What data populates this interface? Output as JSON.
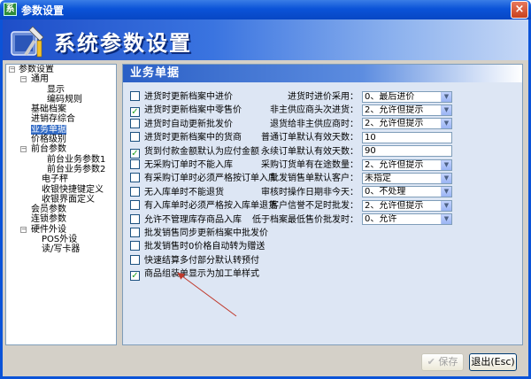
{
  "window": {
    "title": "参数设置",
    "close_glyph": "×"
  },
  "banner": {
    "title": "系统参数设置"
  },
  "tree": {
    "nodes": [
      {
        "label": "参数设置",
        "level": "0",
        "expander": "−"
      },
      {
        "label": "通用",
        "level": "1",
        "expander": "−"
      },
      {
        "label": "显示",
        "level": "2b"
      },
      {
        "label": "编码规则",
        "level": "2b"
      },
      {
        "label": "基础档案",
        "level": "1"
      },
      {
        "label": "进销存综合",
        "level": "1"
      },
      {
        "label": "业务单据",
        "level": "1",
        "selected": true
      },
      {
        "label": "价格级别",
        "level": "1"
      },
      {
        "label": "前台参数",
        "level": "1",
        "expander": "−"
      },
      {
        "label": "前台业务参数1",
        "level": "2b"
      },
      {
        "label": "前台业务参数2",
        "level": "2b"
      },
      {
        "label": "电子秤",
        "level": "2"
      },
      {
        "label": "收银快捷键定义",
        "level": "2"
      },
      {
        "label": "收银界面定义",
        "level": "2"
      },
      {
        "label": "会员参数",
        "level": "1"
      },
      {
        "label": "连锁参数",
        "level": "1"
      },
      {
        "label": "硬件外设",
        "level": "1",
        "expander": "−"
      },
      {
        "label": "POS外设",
        "level": "2"
      },
      {
        "label": "读/写卡器",
        "level": "2"
      }
    ]
  },
  "panel": {
    "header": "业务单据",
    "checkboxes": [
      {
        "label": "进货时更新档案中进价",
        "checked": false
      },
      {
        "label": "进货时更新档案中零售价",
        "checked": true
      },
      {
        "label": "进货时自动更新批发价",
        "checked": false
      },
      {
        "label": "进货时更新档案中的货商",
        "checked": false
      },
      {
        "label": "货到付款金额默认为应付金额",
        "checked": true
      },
      {
        "label": "无采购订单时不能入库",
        "checked": false
      },
      {
        "label": "有采购订单时必须严格按订单入库",
        "checked": false
      },
      {
        "label": "无入库单时不能退货",
        "checked": false
      },
      {
        "label": "有入库单时必须严格按入库单退货",
        "checked": false
      },
      {
        "label": "允许不管理库存商品入库",
        "checked": false
      },
      {
        "label": "批发销售同步更新档案中批发价",
        "checked": false
      },
      {
        "label": "批发销售时0价格自动转为赠送",
        "checked": false
      },
      {
        "label": "快速结算多付部分默认转预付",
        "checked": false
      },
      {
        "label": "商品组装单显示为加工单样式",
        "checked": true
      }
    ],
    "fields": [
      {
        "label": "进货时进价采用：",
        "value": "0、最后进价",
        "dropdown": true
      },
      {
        "label": "非主供应商头次进货：",
        "value": "2、允许但提示",
        "dropdown": true
      },
      {
        "label": "退货给非主供应商时：",
        "value": "2、允许但提示",
        "dropdown": true
      },
      {
        "label": "普通订单默认有效天数：",
        "value": "10",
        "dropdown": false
      },
      {
        "label": "永续订单默认有效天数：",
        "value": "90",
        "dropdown": false
      },
      {
        "label": "采购订货单有在途数量：",
        "value": "2、允许但提示",
        "dropdown": true
      },
      {
        "label": "批发销售单默认客户：",
        "value": "未指定",
        "dropdown": true
      },
      {
        "label": "审核时操作日期非今天：",
        "value": "0、不处理",
        "dropdown": true
      },
      {
        "label": "客户信誉不足时批发：",
        "value": "2、允许但提示",
        "dropdown": true
      },
      {
        "label": "低于档案最低售价批发时：",
        "value": "0、允许",
        "dropdown": true
      }
    ]
  },
  "buttons": {
    "save": "保存",
    "exit": "退出(Esc)"
  },
  "colors": {
    "title_bar": "#0b53d8",
    "panel_body": "#dde6f4",
    "annotation_arrow": "#c0392b"
  }
}
